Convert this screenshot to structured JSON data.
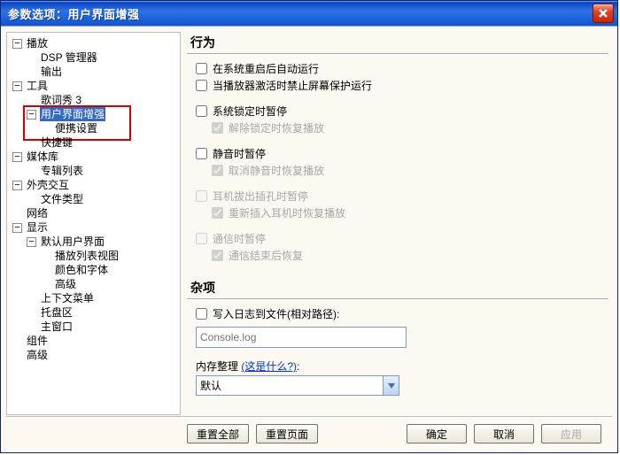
{
  "window": {
    "title": "参数选项：用户界面增强"
  },
  "tree": {
    "playback": {
      "label": "播放",
      "expanded": true,
      "dsp": "DSP 管理器",
      "output": "输出"
    },
    "tools": {
      "label": "工具",
      "expanded": true,
      "lyrics": "歌词秀 3",
      "uie": {
        "label": "用户界面增强",
        "expanded": true,
        "selected": true,
        "portable": "便携设置"
      },
      "hotkeys": "快捷键"
    },
    "library": {
      "label": "媒体库",
      "expanded": true,
      "albums": "专辑列表"
    },
    "shell": {
      "label": "外壳交互",
      "expanded": true,
      "ftype": "文件类型"
    },
    "network": "网络",
    "display": {
      "label": "显示",
      "expanded": true,
      "defui": {
        "label": "默认用户界面",
        "expanded": true,
        "plview": "播放列表视图",
        "colors": "颜色和字体",
        "adv": "高级"
      },
      "ctxmenu": "上下文菜单",
      "tray": "托盘区",
      "mainwin": "主窗口"
    },
    "components": "组件",
    "advanced": "高级"
  },
  "sections": {
    "behavior": {
      "title": "行为",
      "autorun": "在系统重启后自动运行",
      "screensaver": "当播放器激活时禁止屏幕保护运行",
      "lockpause": "系统锁定时暂停",
      "lockpause_sub": "解除锁定时恢复播放",
      "mutepause": "静音时暂停",
      "mutepause_sub": "取消静音时恢复播放",
      "hpunplug": "耳机拔出插孔时暂停",
      "hpunplug_sub": "重新插入耳机时恢复播放",
      "commpause": "通信时暂停",
      "commpause_sub": "通信结束后恢复"
    },
    "misc": {
      "title": "杂项",
      "log": "写入日志到文件(相对路径):",
      "log_placeholder": "Console.log",
      "mem_label": "内存整理",
      "mem_what": "(这是什么?)",
      "mem_colon": ":",
      "mem_value": "默认"
    }
  },
  "buttons": {
    "reset_all": "重置全部",
    "reset_page": "重置页面",
    "ok": "确定",
    "cancel": "取消",
    "apply": "应用"
  }
}
